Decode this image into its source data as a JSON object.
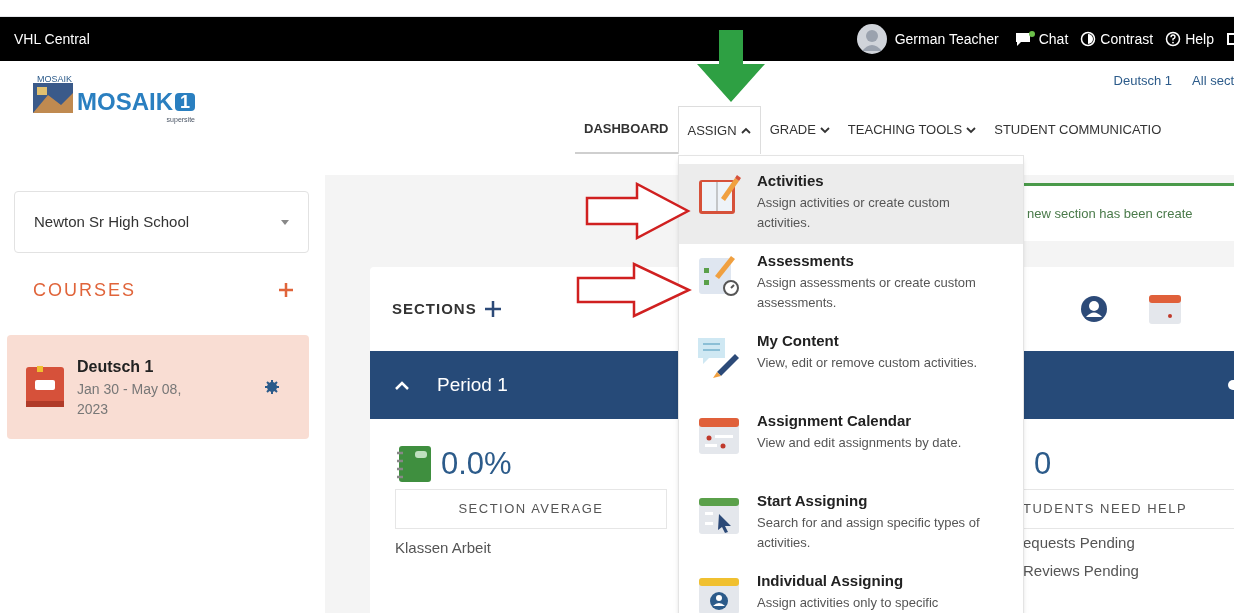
{
  "topbar": {
    "brand": "VHL Central",
    "user": "German Teacher",
    "actions": [
      {
        "kind": "chat",
        "label": "Chat"
      },
      {
        "kind": "contrast",
        "label": "Contrast"
      },
      {
        "kind": "help",
        "label": "Help"
      }
    ]
  },
  "logo": {
    "small_title": "MOSAIK",
    "title": "MOSAIK",
    "badge": "1",
    "subtitle": "supersite"
  },
  "breadcrumb": [
    "Deutsch 1",
    "All sect"
  ],
  "nav": [
    {
      "label": "DASHBOARD",
      "kind": "link",
      "selected": true,
      "expanded": false
    },
    {
      "label": "ASSIGN",
      "kind": "dropdown",
      "selected": false,
      "expanded": true
    },
    {
      "label": "GRADE",
      "kind": "dropdown",
      "selected": false,
      "expanded": false
    },
    {
      "label": "TEACHING TOOLS",
      "kind": "dropdown",
      "selected": false,
      "expanded": false
    },
    {
      "label": "STUDENT COMMUNICATIO",
      "kind": "link",
      "selected": false,
      "expanded": false
    }
  ],
  "assign_menu": [
    {
      "kind": "activities",
      "title": "Activities",
      "description": "Assign activities or create custom activities.",
      "selected": true
    },
    {
      "kind": "assessments",
      "title": "Assessments",
      "description": "Assign assessments or create custom assessments.",
      "selected": false
    },
    {
      "kind": "content",
      "title": "My Content",
      "description": "View, edit or remove custom activities.",
      "selected": false
    },
    {
      "kind": "calendar",
      "title": "Assignment Calendar",
      "description": "View and edit assignments by date.",
      "selected": false
    },
    {
      "kind": "start",
      "title": "Start Assigning",
      "description": "Search for and assign specific types of activities.",
      "selected": false
    },
    {
      "kind": "individual",
      "title": "Individual Assigning",
      "description": "Assign activities only to specific",
      "selected": false
    }
  ],
  "sidebar": {
    "school": "Newton Sr High School",
    "courses_heading": "COURSES",
    "courses": [
      {
        "name": "Deutsch 1",
        "dates": "Jan 30 - May 08, 2023",
        "selected": true
      }
    ]
  },
  "alert": {
    "text": "new section has been create"
  },
  "sections": {
    "heading": "SECTIONS",
    "period": {
      "name": "Period 1",
      "expanded": true
    },
    "average": {
      "value": "0.0%",
      "label": "SECTION AVERAGE",
      "item": "Klassen Arbeit"
    },
    "help": {
      "value": "0",
      "label": "TUDENTS NEED HELP",
      "items": [
        "equests Pending",
        "Reviews Pending"
      ]
    }
  }
}
